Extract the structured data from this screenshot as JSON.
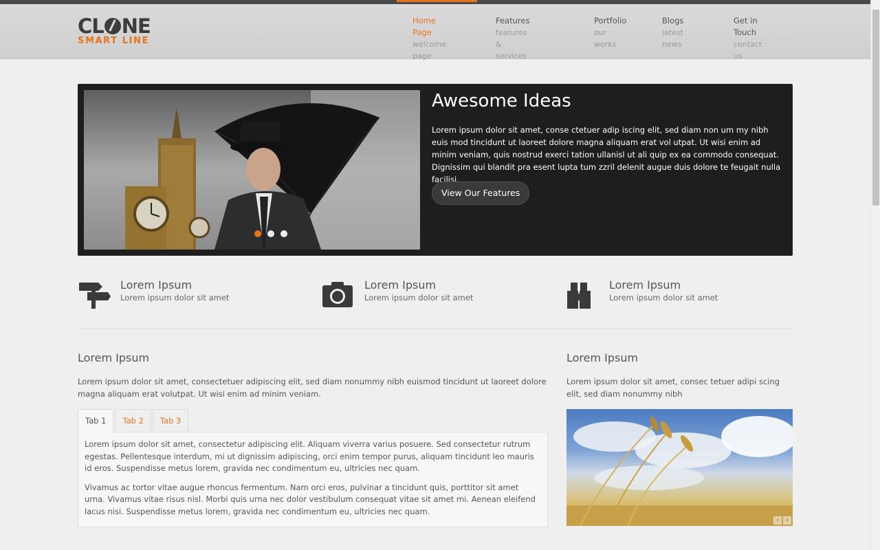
{
  "logo": {
    "line1_a": "CL",
    "line1_b": "NE",
    "line2": "SMART LINE"
  },
  "nav": [
    {
      "title": "Home Page",
      "subtitle": "welcome page",
      "active": true
    },
    {
      "title": "Features",
      "subtitle": "features & services"
    },
    {
      "title": "Portfolio",
      "subtitle": "our works"
    },
    {
      "title": "Blogs",
      "subtitle": "latest news"
    },
    {
      "title": "Get in Touch",
      "subtitle": "contact us"
    }
  ],
  "slider": {
    "title": "Awesome Ideas",
    "text": "Lorem ipsum dolor sit amet, conse ctetuer adip iscing elit, sed diam non um my nibh euis mod tincidunt ut laoreet dolore magna aliquam erat vol utpat. Ut wisi enim ad minim veniam, quis nostrud exerci tation ullanisl ut ali quip ex ea commodo consequat. Dignissim qui blandit pra esent lupta tum zzril delenit augue duis dolore te feugait nulla facilisi.",
    "button": "View Our Features"
  },
  "features": [
    {
      "icon": "signpost-icon",
      "title": "Lorem Ipsum",
      "subtitle": "Lorem ipsum dolor sit amet"
    },
    {
      "icon": "camera-icon",
      "title": "Lorem Ipsum",
      "subtitle": "Lorem ipsum dolor sit amet"
    },
    {
      "icon": "binoculars-icon",
      "title": "Lorem Ipsum",
      "subtitle": "Lorem ipsum dolor sit amet"
    }
  ],
  "main": {
    "title": "Lorem Ipsum",
    "text": "Lorem ipsum dolor sit amet, consectetuer adipiscing elit, sed diam nonummy nibh euismod tincidunt ut laoreet dolore magna aliquam erat volutpat. Ut wisi enim ad minim veniam.",
    "tabs": [
      "Tab 1",
      "Tab 2",
      "Tab 3"
    ],
    "panel_p1": "Lorem ipsum dolor sit amet, consectetur adipiscing elit. Aliquam viverra varius posuere. Sed consectetur rutrum egestas. Pellentesque interdum, mi ut dignissim adipiscing, orci enim tempor purus, aliquam tincidunt leo mauris id eros. Suspendisse metus lorem, gravida nec condimentum eu, ultricies nec quam.",
    "panel_p2": "Vivamus ac tortor vitae augue rhoncus fermentum. Nam orci eros, pulvinar a tincidunt quis, porttitor sit amet urna. Vivamus vitae risus nisl. Morbi quis urna nec dolor vestibulum consequat vitae sit amet mi. Aenean eleifend lacus nisi. Suspendisse metus lorem, gravida nec condimentum eu, ultricies nec quam."
  },
  "side": {
    "title": "Lorem Ipsum",
    "text": "Lorem ipsum dolor sit amet, consec tetuer adipi scing elit, sed diam nonummy nibh",
    "prev": "‹",
    "next": "›"
  },
  "colors": {
    "accent": "#e8731e",
    "dark": "#1e1e1e"
  }
}
